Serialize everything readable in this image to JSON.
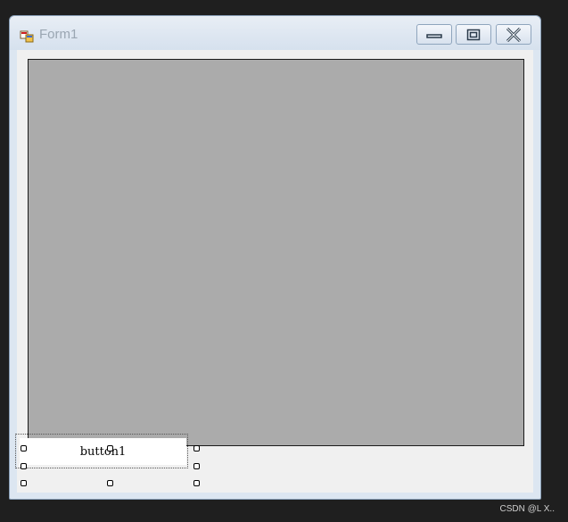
{
  "window": {
    "title": "Form1",
    "controls": {
      "minimize_icon": "minimize-icon",
      "maximize_icon": "maximize-icon",
      "close_icon": "close-icon"
    }
  },
  "form": {
    "panel": {
      "background": "#ababab"
    },
    "button1": {
      "label": "button1"
    }
  },
  "watermark": {
    "text": "CSDN @L X.."
  }
}
